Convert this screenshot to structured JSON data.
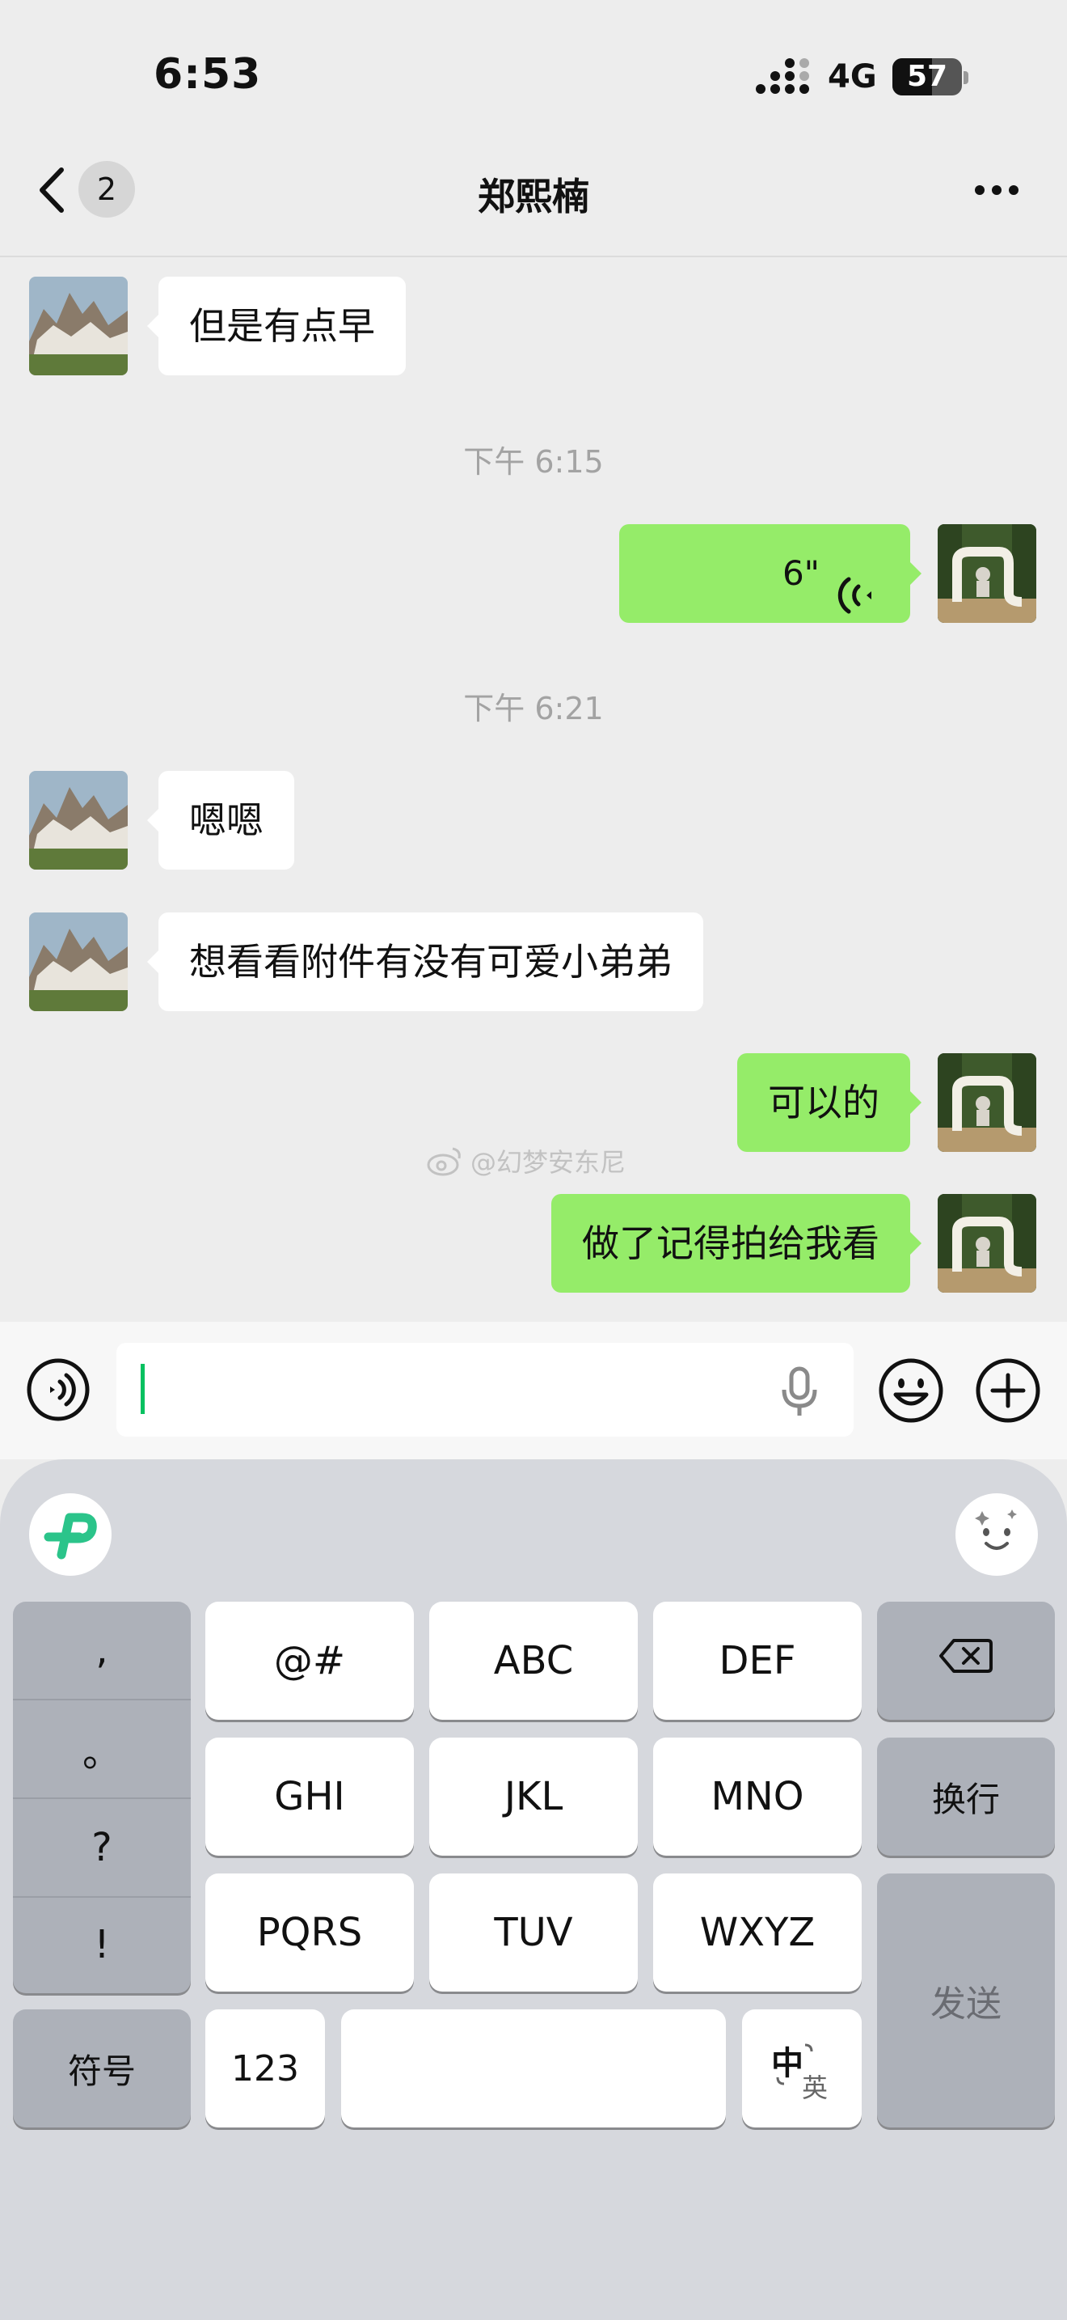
{
  "status_bar": {
    "time": "6:53",
    "network": "4G",
    "battery": "57",
    "battery_level": 0.57
  },
  "nav": {
    "back_count": "2",
    "title": "郑熙楠"
  },
  "messages": {
    "m1": "但是有点早",
    "time1": "下午 6:15",
    "voice_duration": "6\"",
    "time2": "下午 6:21",
    "m3": "嗯嗯",
    "m4": "想看看附件有没有可爱小弟弟",
    "m5": "可以的",
    "m6": "做了记得拍给我看"
  },
  "watermark": "@幻梦安东尼",
  "input": {
    "value": "",
    "placeholder": ""
  },
  "keyboard": {
    "punct": [
      ",",
      "。",
      "?",
      "!"
    ],
    "row1": [
      "@#",
      "ABC",
      "DEF"
    ],
    "row2": [
      "GHI",
      "JKL",
      "MNO"
    ],
    "row3": [
      "PQRS",
      "TUV",
      "WXYZ"
    ],
    "symbols": "符号",
    "numbers": "123",
    "lang_main": "中",
    "lang_alt": "英",
    "newline": "换行",
    "send": "发送"
  },
  "colors": {
    "outgoing": "#95ec69",
    "incoming": "#ffffff",
    "accent": "#07c160",
    "background": "#ededed"
  },
  "icons": [
    "signal-icon",
    "battery-icon",
    "back-chevron-icon",
    "more-icon",
    "voice-message-icon",
    "voice-toggle-icon",
    "microphone-icon",
    "emoji-icon",
    "plus-icon",
    "backspace-icon",
    "keyboard-logo-icon",
    "face-icon",
    "weibo-icon"
  ]
}
